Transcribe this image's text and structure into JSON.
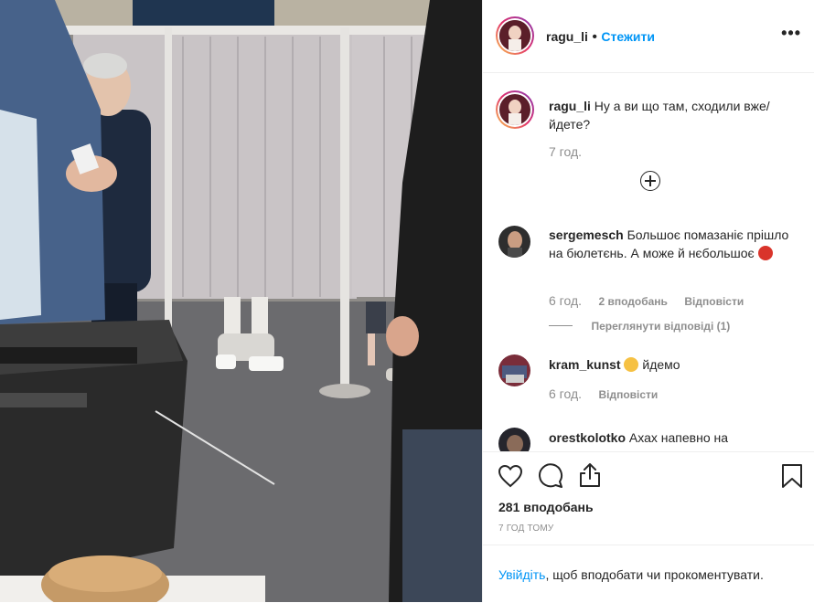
{
  "post": {
    "username": "ragu_li",
    "dot": "•",
    "follow_label": "Стежити",
    "more_icon": "more-horizontal-icon"
  },
  "caption": {
    "username": "ragu_li",
    "text": "Ну а ви що там, сходили вже/йдете?",
    "time": "7 год."
  },
  "comments": [
    {
      "username": "sergemesch",
      "text": "Большоє помазаніє прішло на бюлетєнь. А може й нєбольшоє",
      "emoji": "smiling-devil-emoji",
      "time": "6 год.",
      "likes": "2 вподобань",
      "reply": "Відповісти",
      "view_replies": "Переглянути відповіді (1)"
    },
    {
      "username": "kram_kunst",
      "emoji": "grinning-face-emoji",
      "text": "йдемо",
      "time": "6 год.",
      "reply": "Відповісти"
    },
    {
      "username": "orestkolotko",
      "text": "Ахах напевно на"
    }
  ],
  "actions": {
    "likes": "281 вподобань",
    "timestamp": "7 ГОД ТОМУ"
  },
  "login": {
    "link": "Увійдіть",
    "rest": ", щоб вподобати чи прокоментувати."
  },
  "colors": {
    "accent": "#0095f6",
    "text": "#262626",
    "muted": "#8e8e8e",
    "border": "#efefef"
  }
}
